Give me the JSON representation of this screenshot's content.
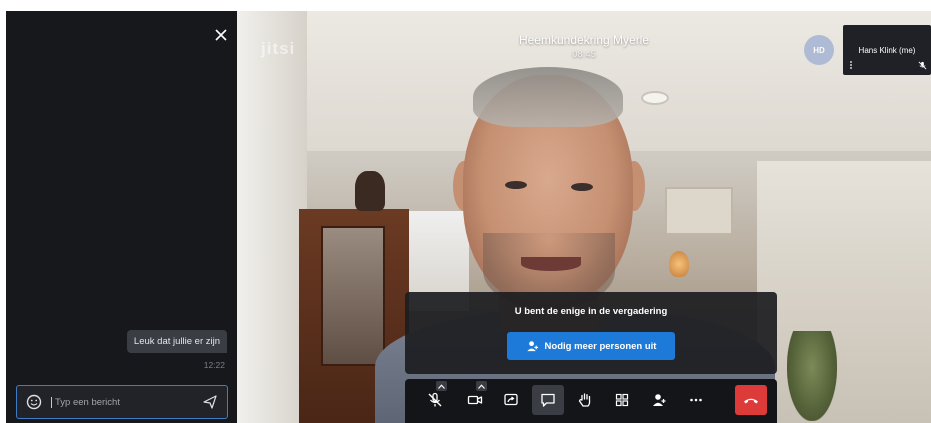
{
  "chat": {
    "message_text": "Leuk dat jullie er zijn",
    "message_time": "12:22",
    "input_placeholder": "Typ een bericht"
  },
  "stage": {
    "watermark": "jitsi",
    "meeting_title": "Heemkundekring Myerle",
    "meeting_time": "08:45",
    "avatar_initials": "HD",
    "local_participant_name": "Hans Klink (me)"
  },
  "notice": {
    "text": "U bent de enige in de vergadering",
    "invite_label": "Nodig meer personen uit"
  },
  "icons": {
    "chat_close": "close-icon",
    "emoji": "emoji-icon",
    "send": "send-icon",
    "mic": "mic-muted-icon",
    "camera": "camera-icon",
    "share": "screen-share-icon",
    "chat": "chat-icon",
    "raise_hand": "raise-hand-icon",
    "tile_view": "tile-view-icon",
    "invite": "invite-icon",
    "more": "more-icon",
    "hangup": "hangup-icon"
  },
  "colors": {
    "panel_bg": "#17181c",
    "invite_button": "#1e7ad8",
    "hangup_button": "#dd3a3a",
    "input_border": "#3f7cc4"
  }
}
